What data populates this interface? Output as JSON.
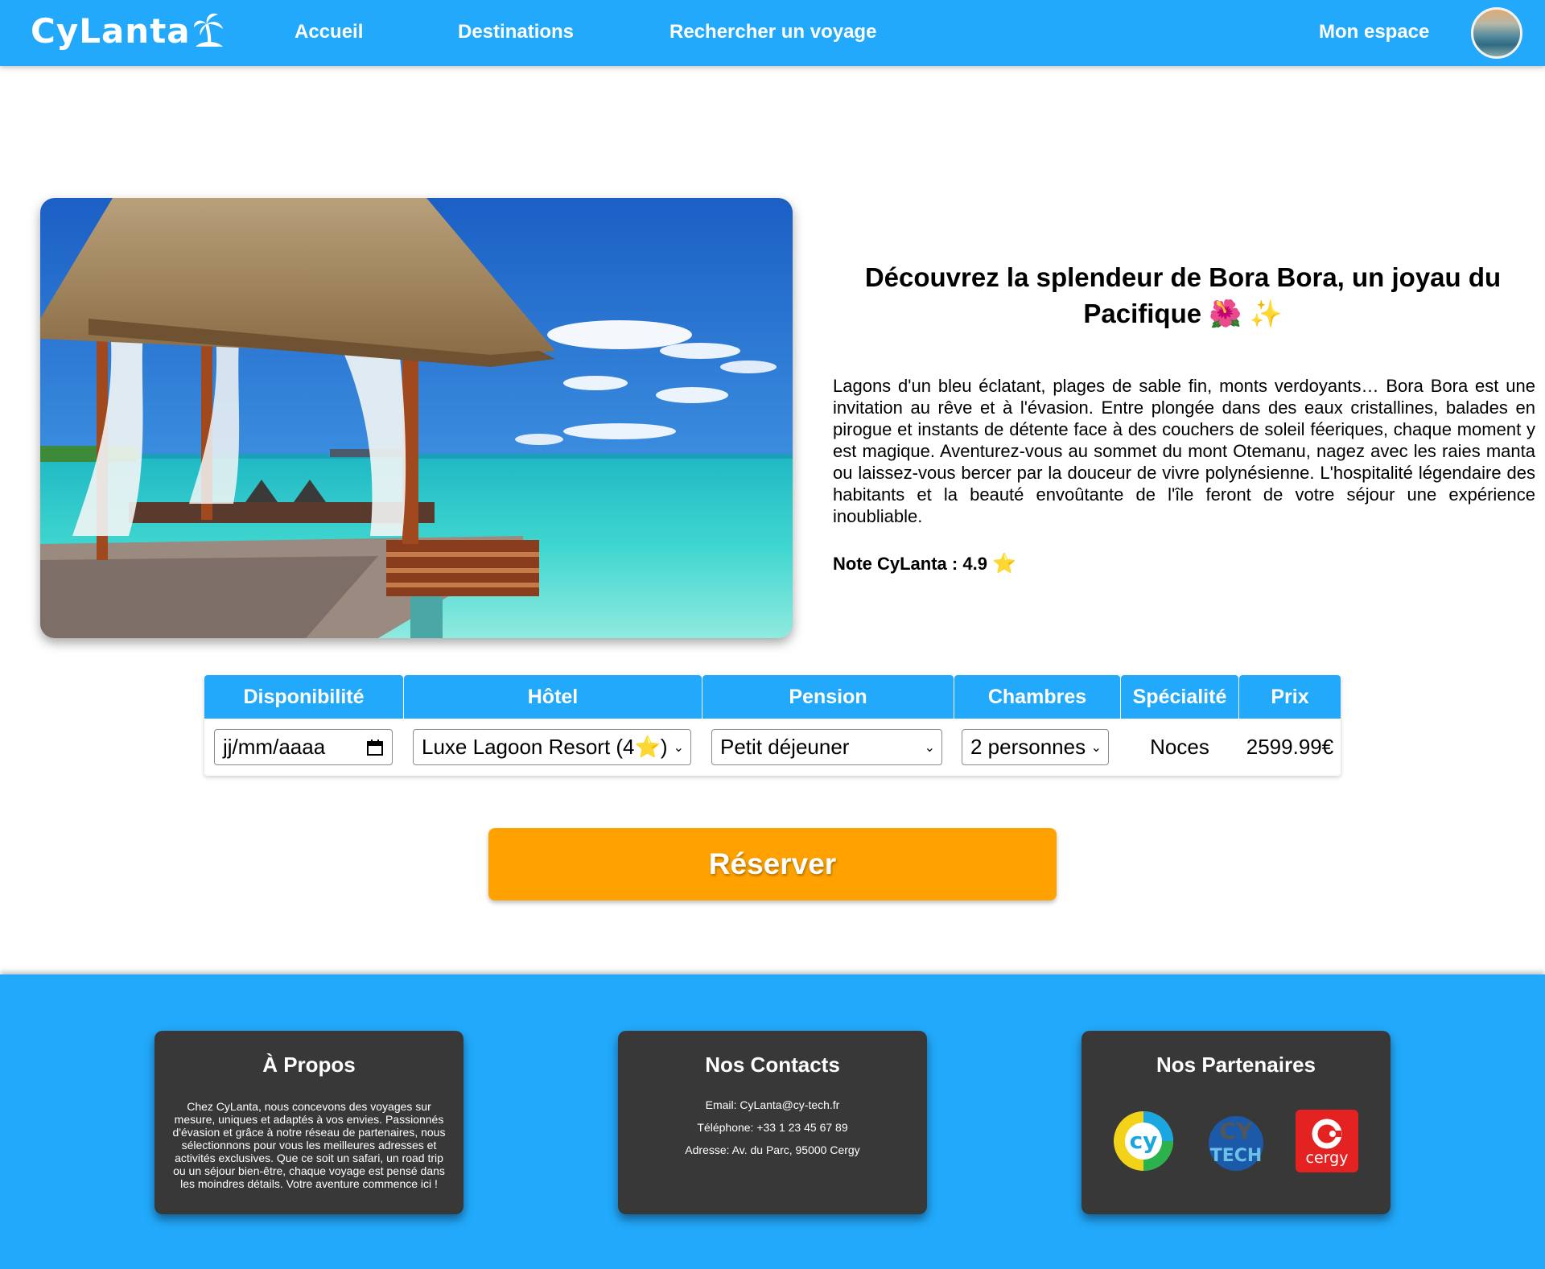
{
  "nav": {
    "logo": "CyLanta",
    "links": [
      "Accueil",
      "Destinations",
      "Rechercher un voyage"
    ],
    "account": "Mon espace"
  },
  "hero": {
    "title": "Découvrez la splendeur de Bora Bora, un joyau du Pacifique 🌺 ✨",
    "description": "Lagons d'un bleu éclatant, plages de sable fin, monts verdoyants… Bora Bora est une invitation au rêve et à l'évasion. Entre plongée dans des eaux cristallines, balades en pirogue et instants de détente face à des couchers de soleil féeriques, chaque moment y est magique. Aventurez-vous au sommet du mont Otemanu, nagez avec les raies manta ou laissez-vous bercer par la douceur de vivre polynésienne. L'hospitalité légendaire des habitants et la beauté envoûtante de l'île feront de votre séjour une expérience inoubliable.",
    "rating_label": "Note CyLanta : 4.9",
    "rating_star": "⭐"
  },
  "booking": {
    "headers": [
      "Disponibilité",
      "Hôtel",
      "Pension",
      "Chambres",
      "Spécialité",
      "Prix"
    ],
    "date_placeholder": "jj/mm/aaaa",
    "hotel": "Luxe Lagoon Resort (4⭐)",
    "pension": "Petit déjeuner",
    "rooms": "2 personnes",
    "specialty": "Noces",
    "price": "2599.99€"
  },
  "reserve_label": "Réserver",
  "footer": {
    "about_title": "À Propos",
    "about_text": "Chez CyLanta, nous concevons des voyages sur mesure, uniques et adaptés à vos envies. Passionnés d'évasion et grâce à notre réseau de partenaires, nous sélectionnons pour vous les meilleures adresses et activités exclusives. Que ce soit un safari, un road trip ou un séjour bien-être, chaque voyage est pensé dans les moindres détails. Votre aventure commence ici !",
    "contacts_title": "Nos Contacts",
    "email": "Email: CyLanta@cy-tech.fr",
    "phone": "Téléphone: +33 1 23 45 67 89",
    "address": "Adresse: Av. du Parc, 95000 Cergy",
    "partners_title": "Nos Partenaires",
    "partner_cy": "cy",
    "partner_cytech_cy": "CY",
    "partner_cytech_tech": "TECH",
    "partner_cergy": "cergy"
  },
  "colors": {
    "primary": "#22a9fb",
    "accent": "#ffa201",
    "card": "#383838"
  }
}
